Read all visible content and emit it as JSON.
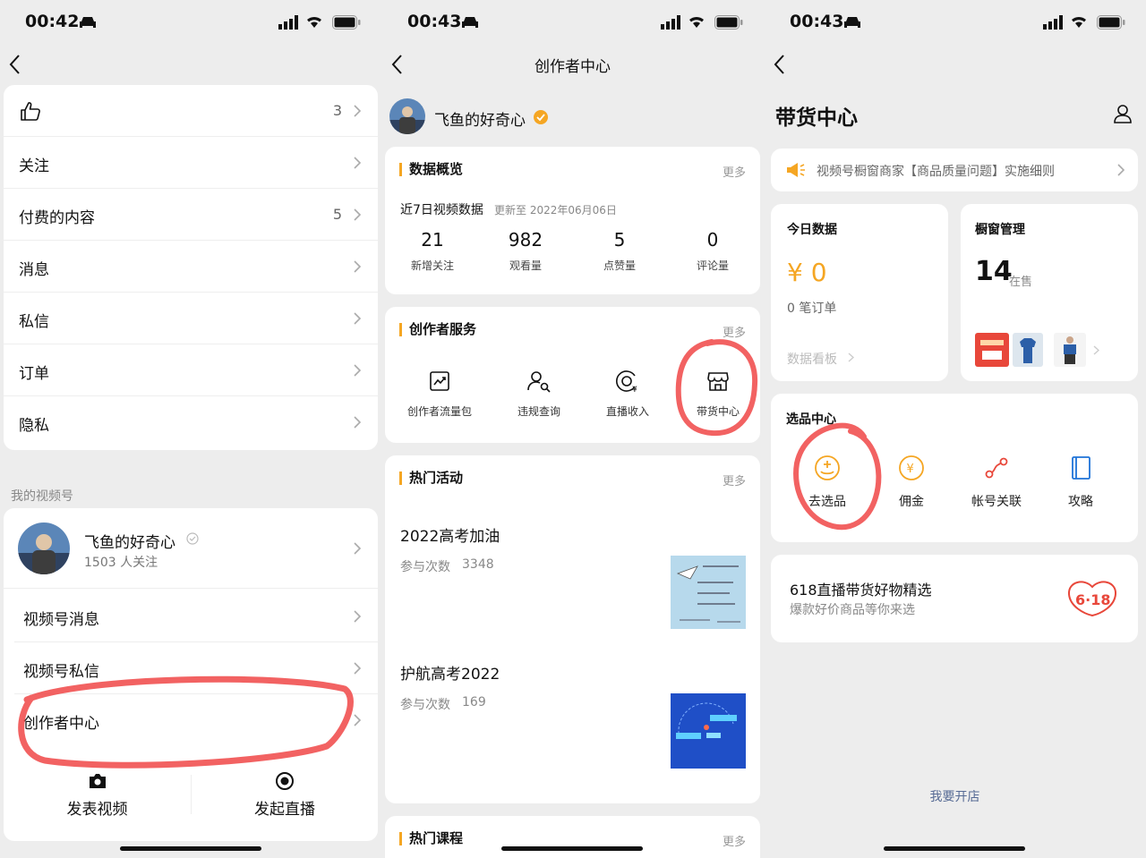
{
  "screen1": {
    "time": "00:42",
    "rows": [
      {
        "label": "",
        "count": "3"
      },
      {
        "label": "关注",
        "count": ""
      },
      {
        "label": "付费的内容",
        "count": "5"
      },
      {
        "label": "消息",
        "count": ""
      },
      {
        "label": "私信",
        "count": ""
      },
      {
        "label": "订单",
        "count": ""
      },
      {
        "label": "隐私",
        "count": ""
      }
    ],
    "section_label": "我的视频号",
    "profile_name": "飞鱼的好奇心",
    "profile_followers": "1503 人关注",
    "items": [
      "视频号消息",
      "视频号私信",
      "创作者中心"
    ],
    "post_video": "发表视频",
    "start_live": "发起直播"
  },
  "screen2": {
    "time": "00:43",
    "title": "创作者中心",
    "user_name": "飞鱼的好奇心",
    "overview": {
      "title": "数据概览",
      "more": "更多",
      "subtitle": "近7日视频数据",
      "updated": "更新至 2022年06月06日",
      "stats": [
        {
          "value": "21",
          "label": "新增关注"
        },
        {
          "value": "982",
          "label": "观看量"
        },
        {
          "value": "5",
          "label": "点赞量"
        },
        {
          "value": "0",
          "label": "评论量"
        }
      ]
    },
    "services": {
      "title": "创作者服务",
      "more": "更多",
      "items": [
        {
          "label": "创作者流量包",
          "icon": "chart-up-icon"
        },
        {
          "label": "违规查询",
          "icon": "user-search-icon"
        },
        {
          "label": "直播收入",
          "icon": "live-income-icon"
        },
        {
          "label": "带货中心",
          "icon": "store-icon"
        }
      ]
    },
    "activities": {
      "title": "热门活动",
      "more": "更多",
      "items": [
        {
          "name": "2022高考加油",
          "count_label": "参与次数",
          "count": "3348"
        },
        {
          "name": "护航高考2022",
          "count_label": "参与次数",
          "count": "169"
        }
      ]
    },
    "courses": {
      "title": "热门课程",
      "more": "更多"
    }
  },
  "screen3": {
    "time": "00:43",
    "title": "带货中心",
    "notice": "视频号橱窗商家【商品质量问题】实施细则",
    "today": {
      "title": "今日数据",
      "amount": "¥ 0",
      "orders": "0 笔订单",
      "board": "数据看板"
    },
    "window": {
      "title": "橱窗管理",
      "count": "14",
      "status": "在售"
    },
    "selection": {
      "title": "选品中心",
      "items": [
        {
          "label": "去选品",
          "icon": "select-product-icon"
        },
        {
          "label": "佣金",
          "icon": "commission-icon"
        },
        {
          "label": "帐号关联",
          "icon": "account-link-icon"
        },
        {
          "label": "攻略",
          "icon": "guide-book-icon"
        }
      ]
    },
    "promo": {
      "title": "618直播带货好物精选",
      "subtitle": "爆款好价商品等你来选"
    },
    "open_store": "我要开店"
  },
  "colors": {
    "accent_orange": "#f5a623",
    "annotation_red": "#ef3b3b",
    "link_blue": "#576b95"
  }
}
